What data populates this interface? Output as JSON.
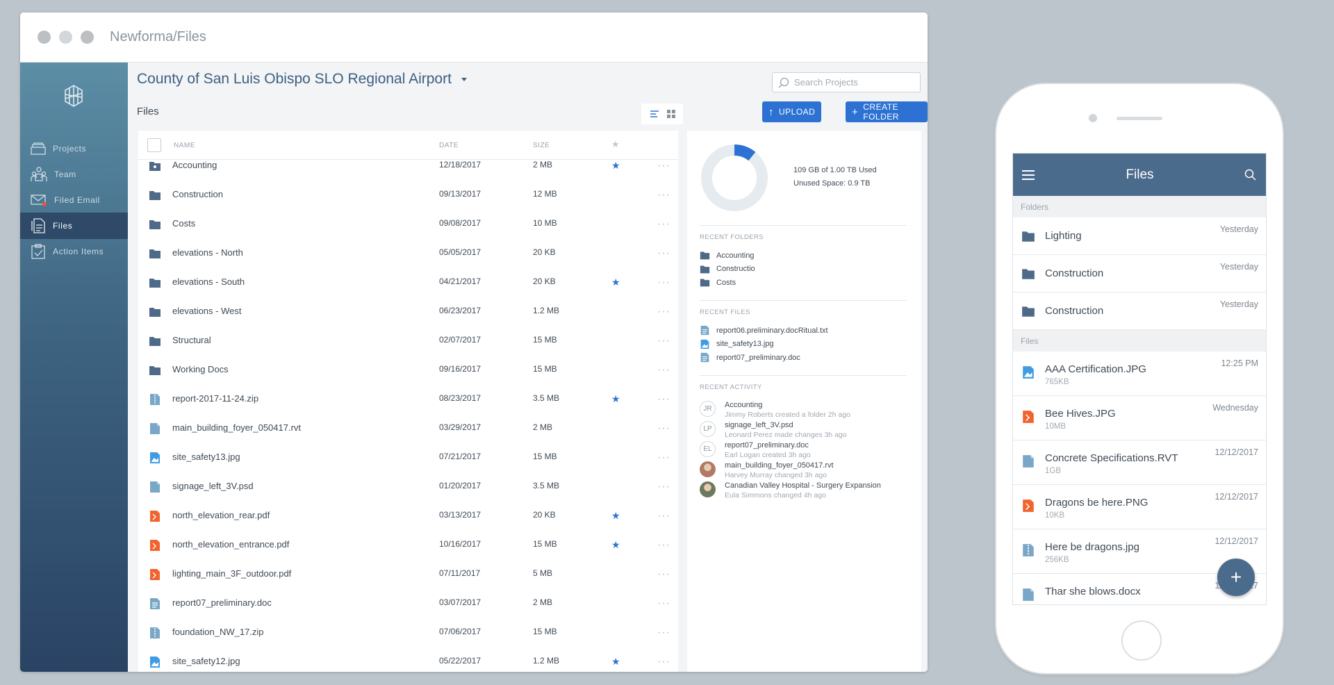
{
  "window": {
    "title": "Newforma/Files"
  },
  "sidebar": {
    "items": [
      {
        "label": "Projects",
        "icon": "projects-icon"
      },
      {
        "label": "Team",
        "icon": "team-icon"
      },
      {
        "label": "Filed Email",
        "icon": "filed-email-icon"
      },
      {
        "label": "Files",
        "icon": "files-icon",
        "active": true
      },
      {
        "label": "Action Items",
        "icon": "action-items-icon"
      }
    ]
  },
  "header": {
    "project_title": "County of San Luis Obispo SLO Regional Airport",
    "search_placeholder": "Search Projects",
    "files_heading": "Files",
    "upload_label": "UPLOAD",
    "create_folder_label": "CREATE FOLDER"
  },
  "table": {
    "columns": {
      "name": "NAME",
      "date": "DATE",
      "size": "SIZE"
    },
    "rows": [
      {
        "name": "Accounting",
        "date": "12/18/2017",
        "size": "2 MB",
        "starred": true,
        "type": "folder-shared"
      },
      {
        "name": "Construction",
        "date": "09/13/2017",
        "size": "12 MB",
        "starred": false,
        "type": "folder"
      },
      {
        "name": "Costs",
        "date": "09/08/2017",
        "size": "10 MB",
        "starred": false,
        "type": "folder"
      },
      {
        "name": "elevations - North",
        "date": "05/05/2017",
        "size": "20 KB",
        "starred": false,
        "type": "folder"
      },
      {
        "name": "elevations - South",
        "date": "04/21/2017",
        "size": "20 KB",
        "starred": true,
        "type": "folder"
      },
      {
        "name": "elevations - West",
        "date": "06/23/2017",
        "size": "1.2 MB",
        "starred": false,
        "type": "folder"
      },
      {
        "name": "Structural",
        "date": "02/07/2017",
        "size": "15 MB",
        "starred": false,
        "type": "folder"
      },
      {
        "name": "Working Docs",
        "date": "09/16/2017",
        "size": "15 MB",
        "starred": false,
        "type": "folder"
      },
      {
        "name": "report-2017-11-24.zip",
        "date": "08/23/2017",
        "size": "3.5 MB",
        "starred": true,
        "type": "zip"
      },
      {
        "name": "main_building_foyer_050417.rvt",
        "date": "03/29/2017",
        "size": "2 MB",
        "starred": false,
        "type": "file"
      },
      {
        "name": "site_safety13.jpg",
        "date": "07/21/2017",
        "size": "15 MB",
        "starred": false,
        "type": "image"
      },
      {
        "name": "signage_left_3V.psd",
        "date": "01/20/2017",
        "size": "3.5 MB",
        "starred": false,
        "type": "file"
      },
      {
        "name": "north_elevation_rear.pdf",
        "date": "03/13/2017",
        "size": "20 KB",
        "starred": true,
        "type": "pdf"
      },
      {
        "name": "north_elevation_entrance.pdf",
        "date": "10/16/2017",
        "size": "15 MB",
        "starred": true,
        "type": "pdf"
      },
      {
        "name": "lighting_main_3F_outdoor.pdf",
        "date": "07/11/2017",
        "size": "5 MB",
        "starred": false,
        "type": "pdf"
      },
      {
        "name": "report07_preliminary.doc",
        "date": "03/07/2017",
        "size": "2 MB",
        "starred": false,
        "type": "doc"
      },
      {
        "name": "foundation_NW_17.zip",
        "date": "07/06/2017",
        "size": "15 MB",
        "starred": false,
        "type": "zip"
      },
      {
        "name": "site_safety12.jpg",
        "date": "05/22/2017",
        "size": "1.2 MB",
        "starred": true,
        "type": "image"
      }
    ]
  },
  "storage": {
    "used_text": "109 GB of 1.00 TB Used",
    "unused_text": "Unused Space: 0.9 TB",
    "used_fraction": 0.109
  },
  "recent_folders": {
    "heading": "RECENT FOLDERS",
    "items": [
      "Accounting",
      "Constructio",
      "Costs"
    ]
  },
  "recent_files": {
    "heading": "RECENT FILES",
    "items": [
      {
        "name": "report06.preliminary.docRitual.txt",
        "type": "doc"
      },
      {
        "name": "site_safety13.jpg",
        "type": "image"
      },
      {
        "name": "report07_preliminary.doc",
        "type": "doc"
      }
    ]
  },
  "recent_activity": {
    "heading": "RECENT ACTIVITY",
    "items": [
      {
        "initials": "JR",
        "title": "Accounting",
        "detail": "Jimmy Roberts created a folder 2h ago"
      },
      {
        "initials": "LP",
        "title": "signage_left_3V.psd",
        "detail": "Leonard Perez made changes 3h ago"
      },
      {
        "initials": "EL",
        "title": "report07_preliminary.doc",
        "detail": "Earl Logan created 3h ago"
      },
      {
        "initials": "",
        "title": "main_building_foyer_050417.rvt",
        "detail": "Harvey Murray changed 3h ago"
      },
      {
        "initials": "",
        "title": "Canadian Valley Hospital - Surgery Expansion",
        "detail": "Eula Simmons changed 4h ago"
      }
    ]
  },
  "mobile": {
    "title": "Files",
    "folders_heading": "Folders",
    "files_heading": "Files",
    "folders": [
      {
        "name": "Lighting",
        "time": "Yesterday"
      },
      {
        "name": "Construction",
        "time": "Yesterday"
      },
      {
        "name": "Construction",
        "time": "Yesterday"
      }
    ],
    "files": [
      {
        "name": "AAA Certification.JPG",
        "size": "765KB",
        "time": "12:25 PM",
        "type": "image"
      },
      {
        "name": "Bee Hives.JPG",
        "size": "10MB",
        "time": "Wednesday",
        "type": "pdf"
      },
      {
        "name": "Concrete Specifications.RVT",
        "size": "1GB",
        "time": "12/12/2017",
        "type": "file"
      },
      {
        "name": "Dragons be here.PNG",
        "size": "10KB",
        "time": "12/12/2017",
        "type": "pdf"
      },
      {
        "name": "Here be dragons.jpg",
        "size": "256KB",
        "time": "12/12/2017",
        "type": "zip"
      },
      {
        "name": "Thar she blows.docx",
        "size": "",
        "time": "12/12/2017",
        "type": "file"
      }
    ],
    "fab_label": "+"
  },
  "colors": {
    "accent": "#2d72d2",
    "folder": "#4f6a88",
    "pdf": "#f2632d",
    "image": "#3f9be3",
    "file": "#7aa7c7",
    "sidebar_top": "#5c8ea6",
    "sidebar_bottom": "#2a4364"
  }
}
